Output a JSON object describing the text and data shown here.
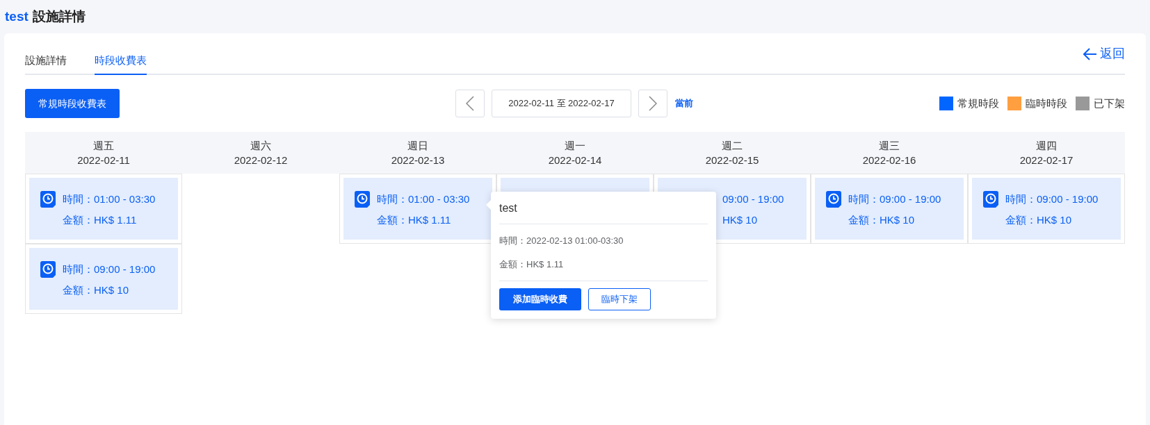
{
  "header": {
    "prefix": "test",
    "title": "設施詳情"
  },
  "tabs": [
    {
      "label": "設施詳情",
      "selected": false
    },
    {
      "label": "時段收費表",
      "selected": true
    }
  ],
  "back_link": {
    "label": "返回"
  },
  "toolbar": {
    "primary_button": "常規時段收費表",
    "date_range": "2022-02-11 至 2022-02-17",
    "current_link": "當前"
  },
  "legend": [
    {
      "label": "常規時段",
      "color": "#0066ff"
    },
    {
      "label": "臨時時段",
      "color": "#ff9f40"
    },
    {
      "label": "已下架",
      "color": "#999999"
    }
  ],
  "days": [
    {
      "weekday": "週五",
      "date": "2022-02-11",
      "slots": [
        {
          "kind": "regular",
          "time_label": "時間：",
          "time": "01:00 - 03:30",
          "amount_label": "金額：",
          "amount": "HK$ 1.11"
        },
        {
          "kind": "regular",
          "time_label": "時間：",
          "time": "09:00 - 19:00",
          "amount_label": "金額：",
          "amount": "HK$ 10"
        }
      ]
    },
    {
      "weekday": "週六",
      "date": "2022-02-12"
    },
    {
      "weekday": "週日",
      "date": "2022-02-13",
      "slots": [
        {
          "kind": "regular",
          "time_label": "時間：",
          "time": "01:00 - 03:30",
          "amount_label": "金額：",
          "amount": "HK$ 1.11"
        }
      ]
    },
    {
      "weekday": "週一",
      "date": "2022-02-14",
      "slots": [
        {
          "kind": "regular"
        }
      ]
    },
    {
      "weekday": "週二",
      "date": "2022-02-15",
      "slots": [
        {
          "kind": "regular",
          "time": "09:00 - 19:00",
          "amount": "HK$ 10"
        }
      ]
    },
    {
      "weekday": "週三",
      "date": "2022-02-16",
      "slots": [
        {
          "kind": "regular",
          "time_label": "時間：",
          "time": "09:00 - 19:00",
          "amount_label": "金額：",
          "amount": "HK$ 10"
        }
      ]
    },
    {
      "weekday": "週四",
      "date": "2022-02-17",
      "slots": [
        {
          "kind": "regular",
          "time_label": "時間：",
          "time": "09:00 - 19:00",
          "amount_label": "金額：",
          "amount": "HK$ 10"
        }
      ]
    }
  ],
  "popover": {
    "title": "test",
    "time_label": "時間：",
    "time": "2022-02-13 01:00-03:30",
    "amount_label": "金額：",
    "amount": "HK$ 1.11",
    "primary_button": "添加臨時收費",
    "secondary_button": "臨時下架"
  }
}
